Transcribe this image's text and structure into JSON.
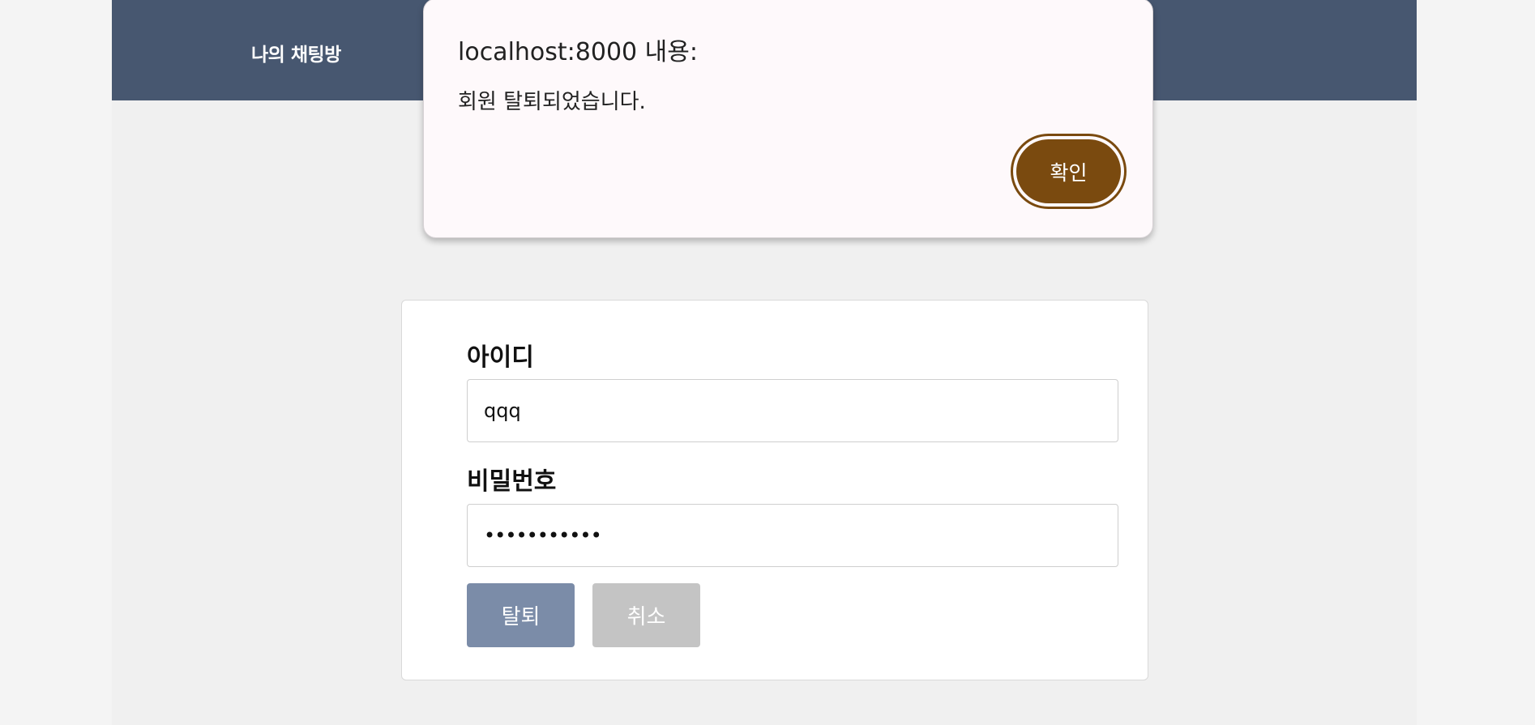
{
  "header": {
    "brand": "나의 채팅방"
  },
  "withdraw_form": {
    "id_label": "아이디",
    "id_value": "qqq",
    "password_label": "비밀번호",
    "password_value": "•••••••••••",
    "withdraw_button": "탈퇴",
    "cancel_button": "취소"
  },
  "alert_dialog": {
    "title": "localhost:8000 내용:",
    "message": "회원 탈퇴되었습니다.",
    "ok_button": "확인"
  },
  "colors": {
    "header_bg": "#475770",
    "withdraw_button": "#7b8ca8",
    "cancel_button": "#c4c4c4",
    "dialog_ok": "#7a4a0f"
  }
}
